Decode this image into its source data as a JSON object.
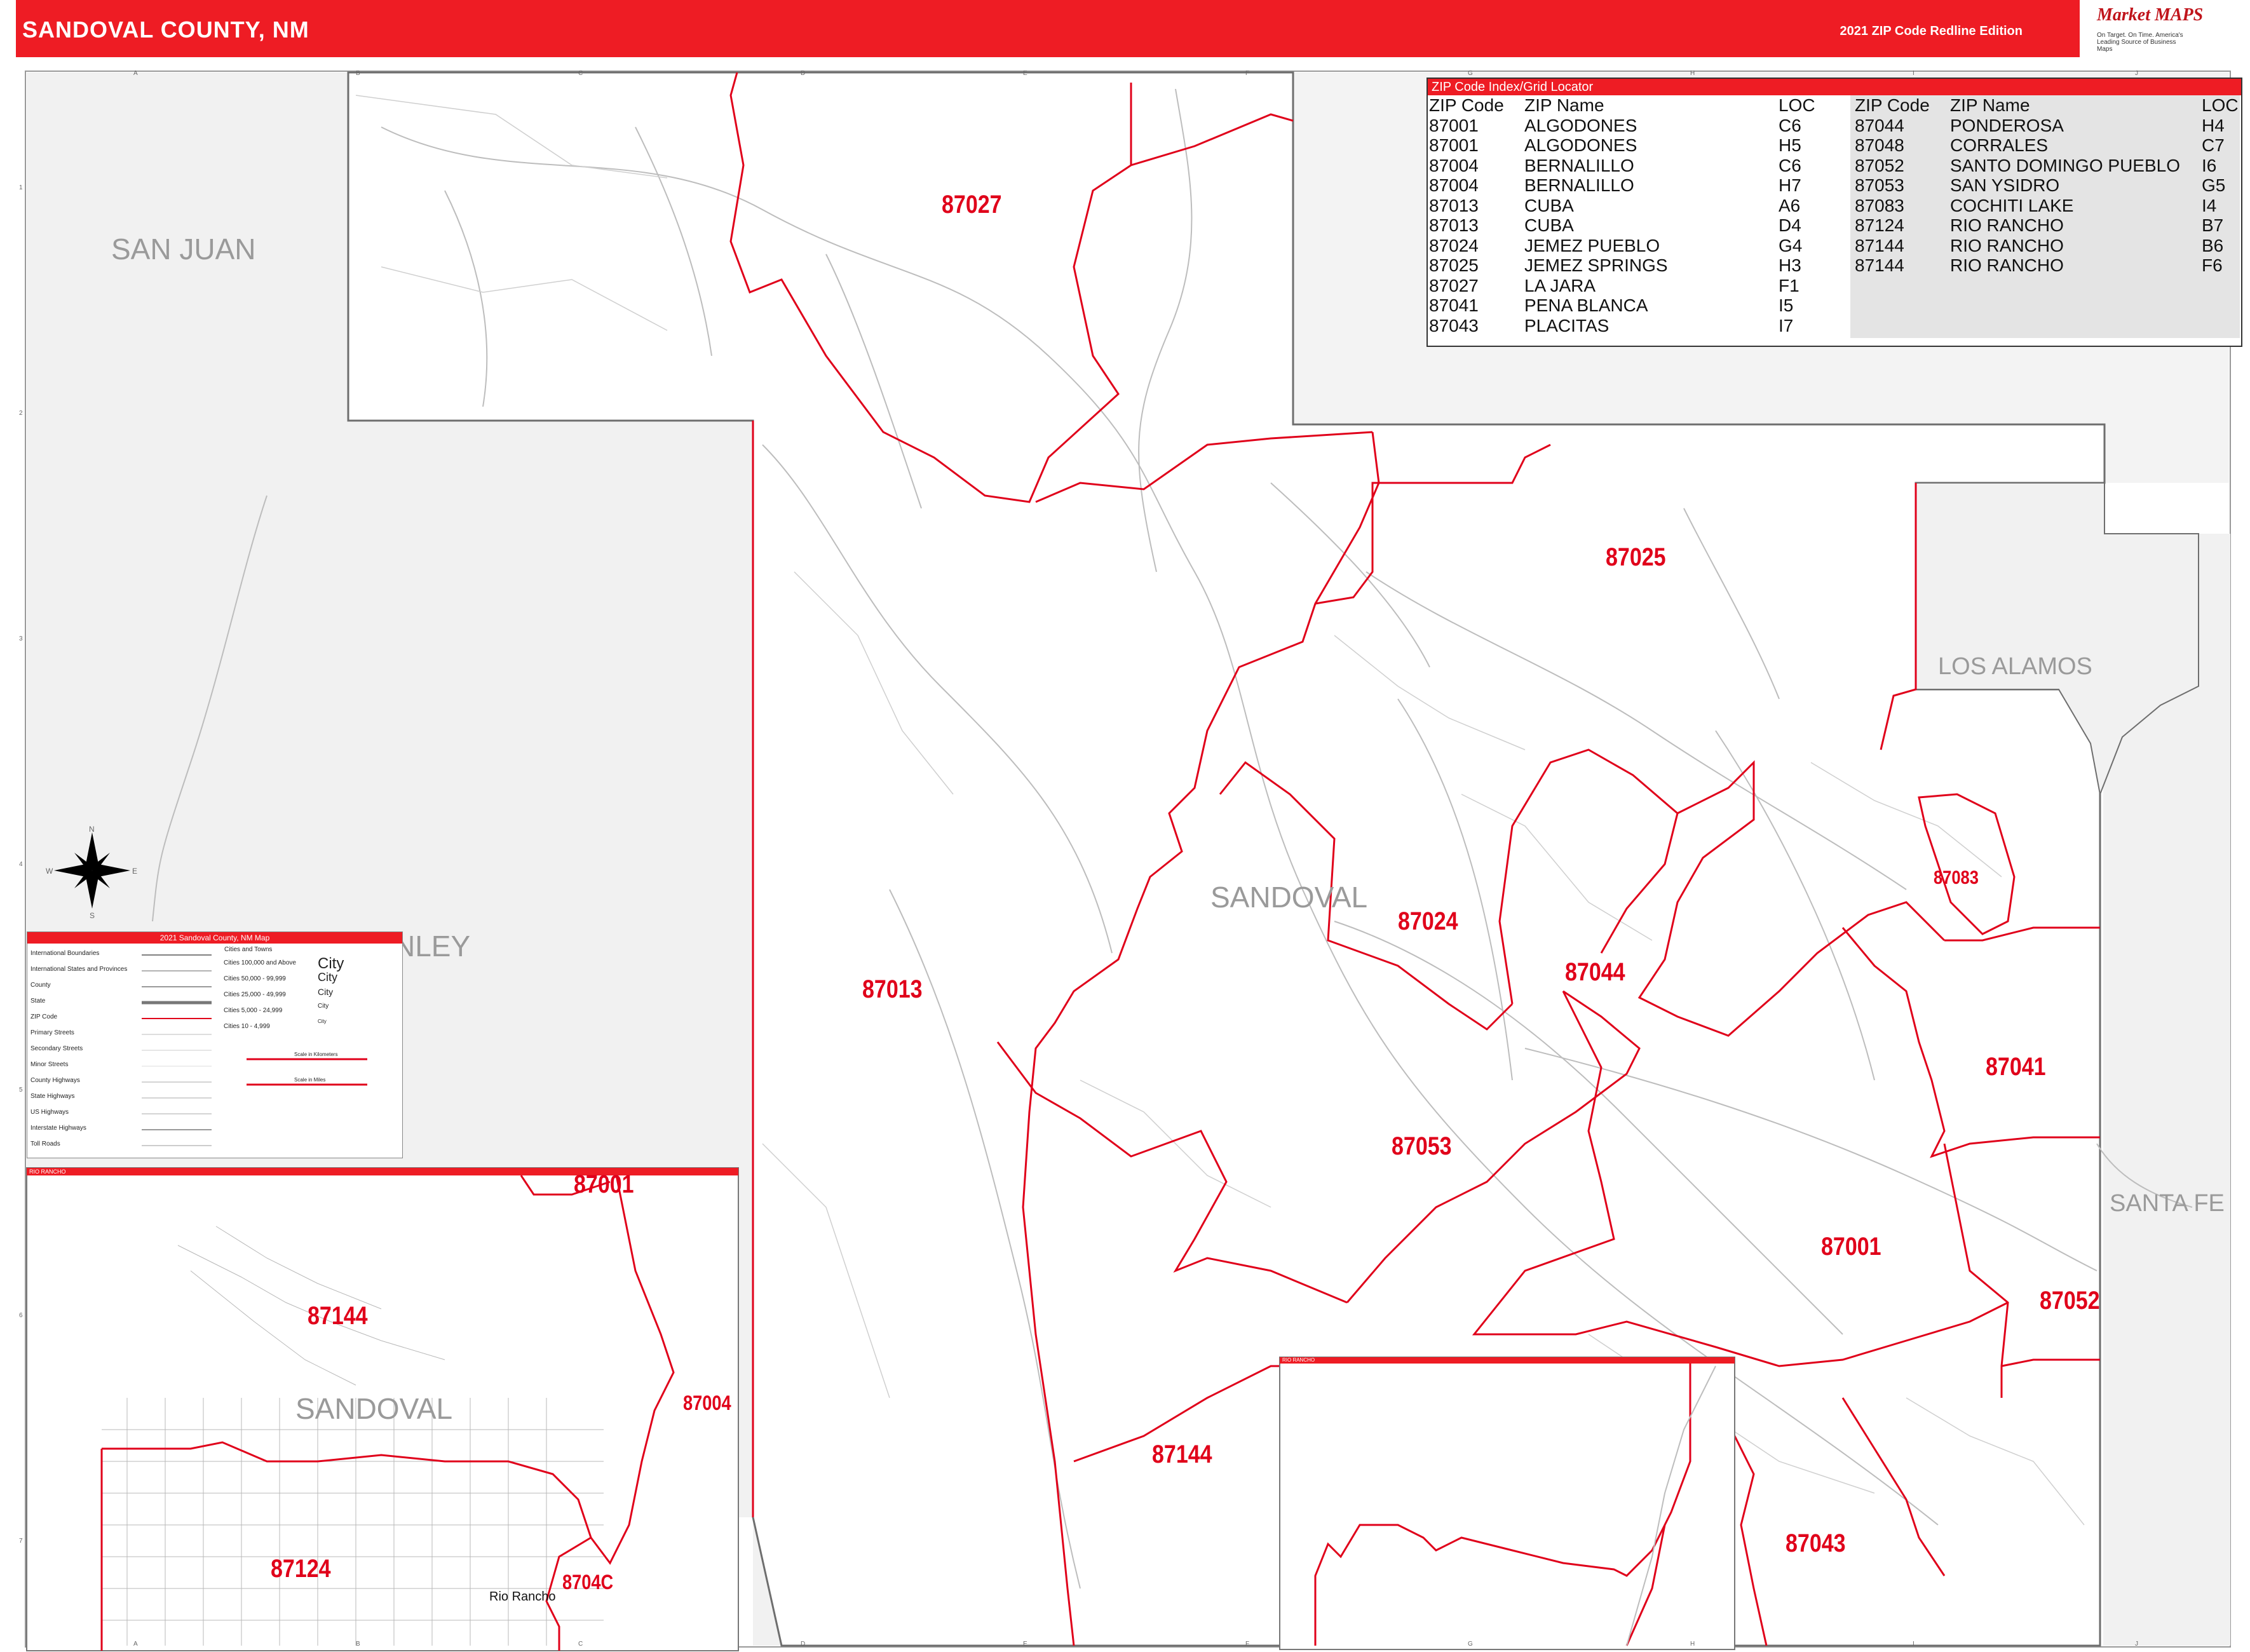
{
  "header": {
    "title": "SANDOVAL COUNTY, NM",
    "edition": "2021 ZIP Code Redline Edition"
  },
  "logo": {
    "name": "Market MAPS",
    "tagline": "On Target. On Time. America's Leading Source of Business Maps"
  },
  "grid": {
    "columns": [
      "A",
      "B",
      "C",
      "D",
      "E",
      "F",
      "G",
      "H",
      "I",
      "J"
    ],
    "rows": [
      "1",
      "2",
      "3",
      "4",
      "5",
      "6",
      "7"
    ]
  },
  "index": {
    "title": "ZIP Code Index/Grid Locator",
    "headers": {
      "code": "ZIP Code",
      "name": "ZIP Name",
      "loc": "LOC"
    },
    "left": [
      {
        "code": "87001",
        "name": "ALGODONES",
        "loc": "C6"
      },
      {
        "code": "87001",
        "name": "ALGODONES",
        "loc": "H5"
      },
      {
        "code": "87004",
        "name": "BERNALILLO",
        "loc": "C6"
      },
      {
        "code": "87004",
        "name": "BERNALILLO",
        "loc": "H7"
      },
      {
        "code": "87013",
        "name": "CUBA",
        "loc": "A6"
      },
      {
        "code": "87013",
        "name": "CUBA",
        "loc": "D4"
      },
      {
        "code": "87024",
        "name": "JEMEZ PUEBLO",
        "loc": "G4"
      },
      {
        "code": "87025",
        "name": "JEMEZ SPRINGS",
        "loc": "H3"
      },
      {
        "code": "87027",
        "name": "LA JARA",
        "loc": "F1"
      },
      {
        "code": "87041",
        "name": "PENA BLANCA",
        "loc": "I5"
      },
      {
        "code": "87043",
        "name": "PLACITAS",
        "loc": "I7"
      }
    ],
    "right": [
      {
        "code": "87044",
        "name": "PONDEROSA",
        "loc": "H4"
      },
      {
        "code": "87048",
        "name": "CORRALES",
        "loc": "C7"
      },
      {
        "code": "87052",
        "name": "SANTO DOMINGO PUEBLO",
        "loc": "I6"
      },
      {
        "code": "87053",
        "name": "SAN YSIDRO",
        "loc": "G5"
      },
      {
        "code": "87083",
        "name": "COCHITI LAKE",
        "loc": "I4"
      },
      {
        "code": "87124",
        "name": "RIO RANCHO",
        "loc": "B7"
      },
      {
        "code": "87144",
        "name": "RIO RANCHO",
        "loc": "B6"
      },
      {
        "code": "87144",
        "name": "RIO RANCHO",
        "loc": "F6"
      }
    ]
  },
  "regions": {
    "san_juan": "SAN JUAN",
    "mckinley": "NLEY",
    "sandoval": "SANDOVAL",
    "los_alamos": "LOS ALAMOS",
    "santa_fe": "SANTA FE",
    "inset_sandoval": "SANDOVAL"
  },
  "zips": {
    "z87027": "87027",
    "z87025": "87025",
    "z87013": "87013",
    "z87024": "87024",
    "z87044": "87044",
    "z87083": "87083",
    "z87041": "87041",
    "z87053": "87053",
    "z87001": "87001",
    "z87052": "87052",
    "z87144": "87144",
    "z87043": "87043",
    "inset_87001": "87001",
    "inset_87144": "87144",
    "inset_87004": "87004",
    "inset_87124": "87124",
    "inset_87048": "8704C"
  },
  "insets": {
    "rio_rancho_label": "RIO RANCHO",
    "rio_rancho_city": "Rio Rancho",
    "east_inset_label": "RIO RANCHO"
  },
  "legend": {
    "title": "2021 Sandoval County, NM Map",
    "left_items": [
      "International Boundaries",
      "International States and Provinces",
      "County",
      "State",
      "ZIP Code",
      "Primary Streets",
      "Secondary Streets",
      "Minor Streets",
      "County Highways",
      "State Highways",
      "US Highways",
      "Interstate Highways",
      "Toll Roads"
    ],
    "right_title": "Cities and Towns",
    "right_items": [
      "Cities 100,000 and Above",
      "Cities 50,000 - 99,999",
      "Cities 25,000 - 49,999",
      "Cities 5,000 - 24,999",
      "Cities 10 - 4,999"
    ],
    "city_samples": [
      "City",
      "City",
      "City",
      "City",
      "City"
    ],
    "scale_km": "Scale in Kilometers",
    "scale_mi": "Scale in Miles"
  },
  "compass": {
    "n": "N",
    "s": "S",
    "e": "E",
    "w": "W"
  },
  "colors": {
    "accent": "#ee1c24",
    "zip_line": "#e0001a",
    "outside_county": "#f2f2f2"
  }
}
